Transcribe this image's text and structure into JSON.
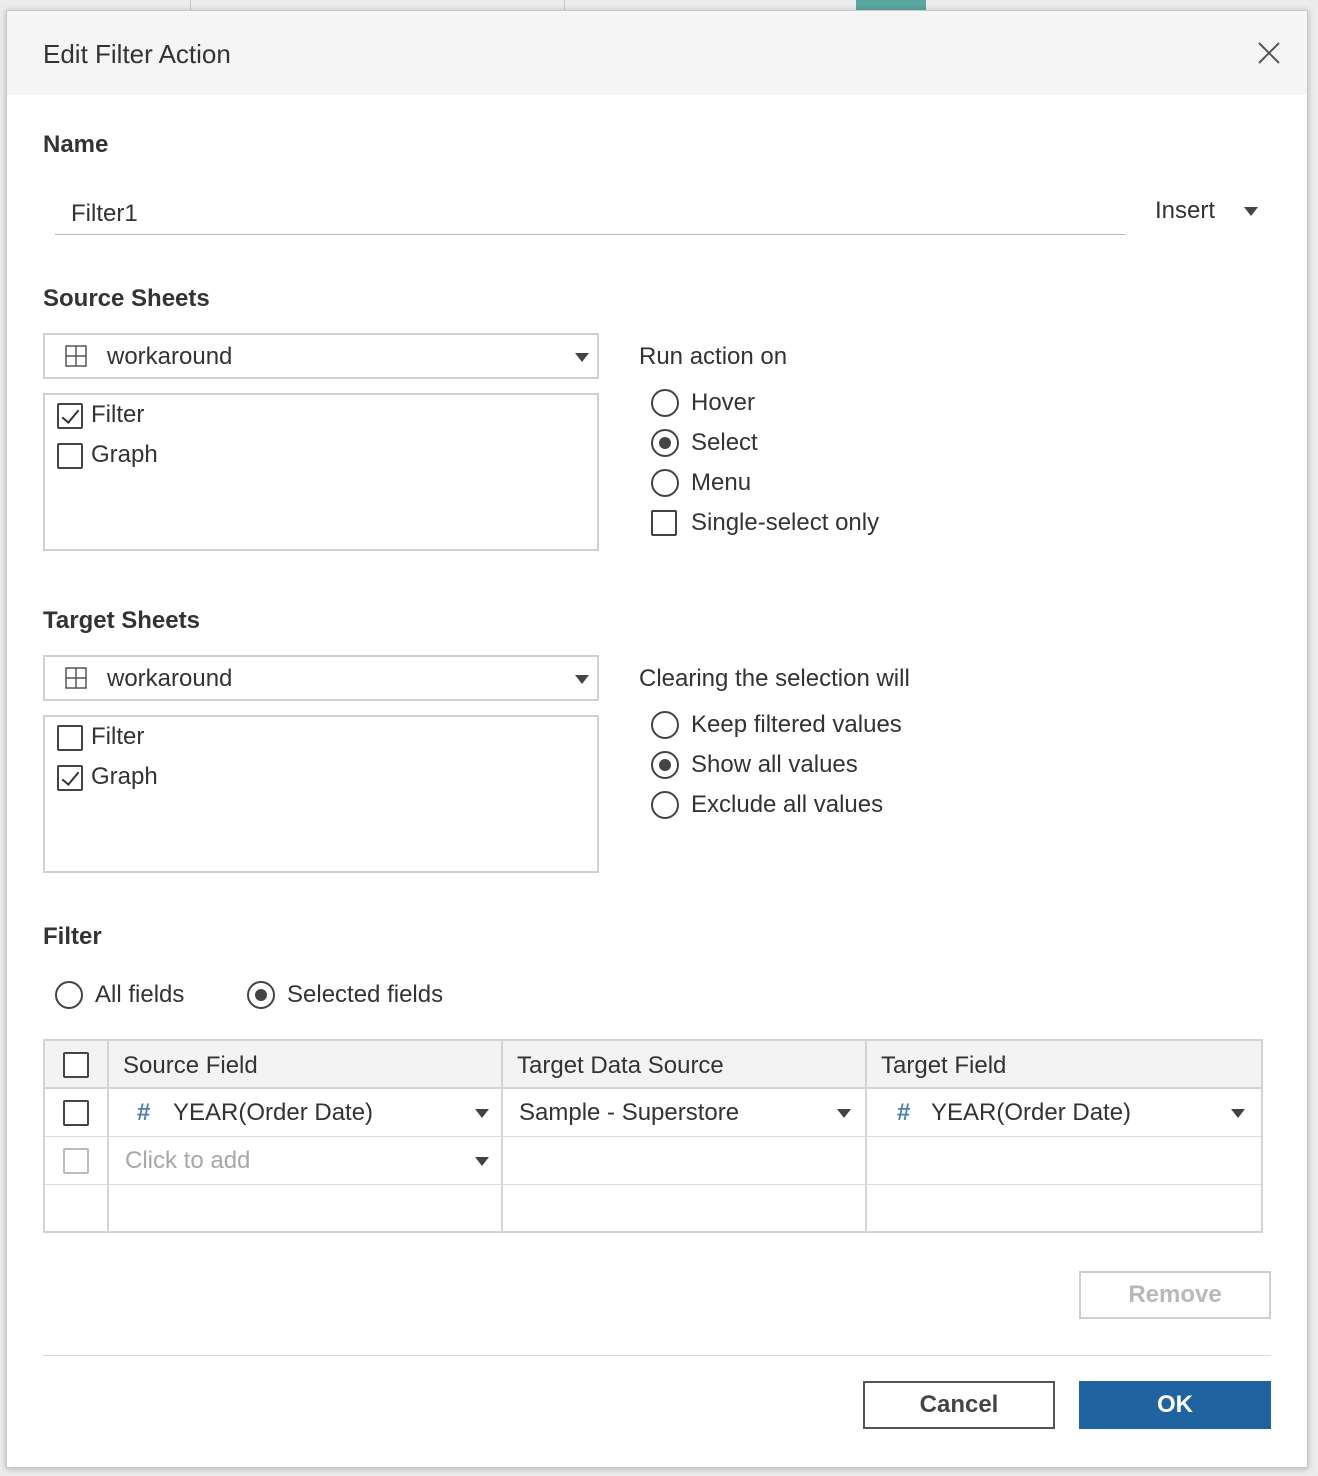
{
  "dialog": {
    "title": "Edit Filter Action"
  },
  "name_section": {
    "label": "Name",
    "value": "Filter1",
    "insert_label": "Insert"
  },
  "source_sheets": {
    "label": "Source Sheets",
    "dropdown_value": "workaround",
    "sheets": [
      {
        "label": "Filter",
        "checked": true
      },
      {
        "label": "Graph",
        "checked": false
      }
    ]
  },
  "run_action_on": {
    "label": "Run action on",
    "options": [
      {
        "label": "Hover",
        "selected": false
      },
      {
        "label": "Select",
        "selected": true
      },
      {
        "label": "Menu",
        "selected": false
      }
    ],
    "single_select_label": "Single-select only",
    "single_select_checked": false
  },
  "target_sheets": {
    "label": "Target Sheets",
    "dropdown_value": "workaround",
    "sheets": [
      {
        "label": "Filter",
        "checked": false
      },
      {
        "label": "Graph",
        "checked": true
      }
    ]
  },
  "clearing": {
    "label": "Clearing the selection will",
    "options": [
      {
        "label": "Keep filtered values",
        "selected": false
      },
      {
        "label": "Show all values",
        "selected": true
      },
      {
        "label": "Exclude all values",
        "selected": false
      }
    ]
  },
  "filter": {
    "label": "Filter",
    "all_fields_label": "All fields",
    "selected_fields_label": "Selected fields",
    "selected_mode": "Selected fields",
    "columns": [
      "Source Field",
      "Target Data Source",
      "Target Field"
    ],
    "rows": [
      {
        "source_field": "YEAR(Order Date)",
        "target_data_source": "Sample - Superstore",
        "target_field": "YEAR(Order Date)"
      }
    ],
    "add_placeholder": "Click to add"
  },
  "buttons": {
    "remove": "Remove",
    "cancel": "Cancel",
    "ok": "OK"
  },
  "colors": {
    "primary": "#1f64a0",
    "field_icon": "#4a7fb0"
  },
  "icons": {
    "close": "close-icon",
    "sheet": "grid-icon",
    "field": "hash-icon"
  }
}
